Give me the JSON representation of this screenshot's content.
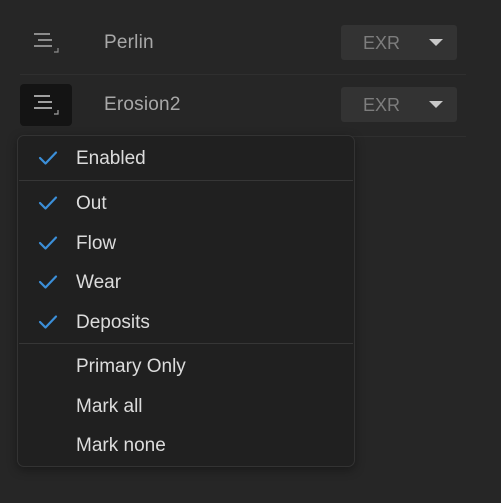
{
  "nodes": [
    {
      "name": "Perlin",
      "format": "EXR",
      "menu_active": false
    },
    {
      "name": "Erosion2",
      "format": "EXR",
      "menu_active": true
    }
  ],
  "dropdown": {
    "enabled": {
      "label": "Enabled",
      "checked": true
    },
    "outputs": [
      {
        "label": "Out",
        "checked": true
      },
      {
        "label": "Flow",
        "checked": true
      },
      {
        "label": "Wear",
        "checked": true
      },
      {
        "label": "Deposits",
        "checked": true
      }
    ],
    "actions": [
      {
        "label": "Primary Only"
      },
      {
        "label": "Mark all"
      },
      {
        "label": "Mark none"
      }
    ]
  },
  "icons": {
    "menu": "menu-lines-icon",
    "check": "checkmark-icon",
    "dropdown_arrow": "caret-down-icon"
  },
  "colors": {
    "background": "#262626",
    "menu_background": "#202020",
    "check_accent": "#3b8fd9",
    "select_background": "#333333"
  }
}
